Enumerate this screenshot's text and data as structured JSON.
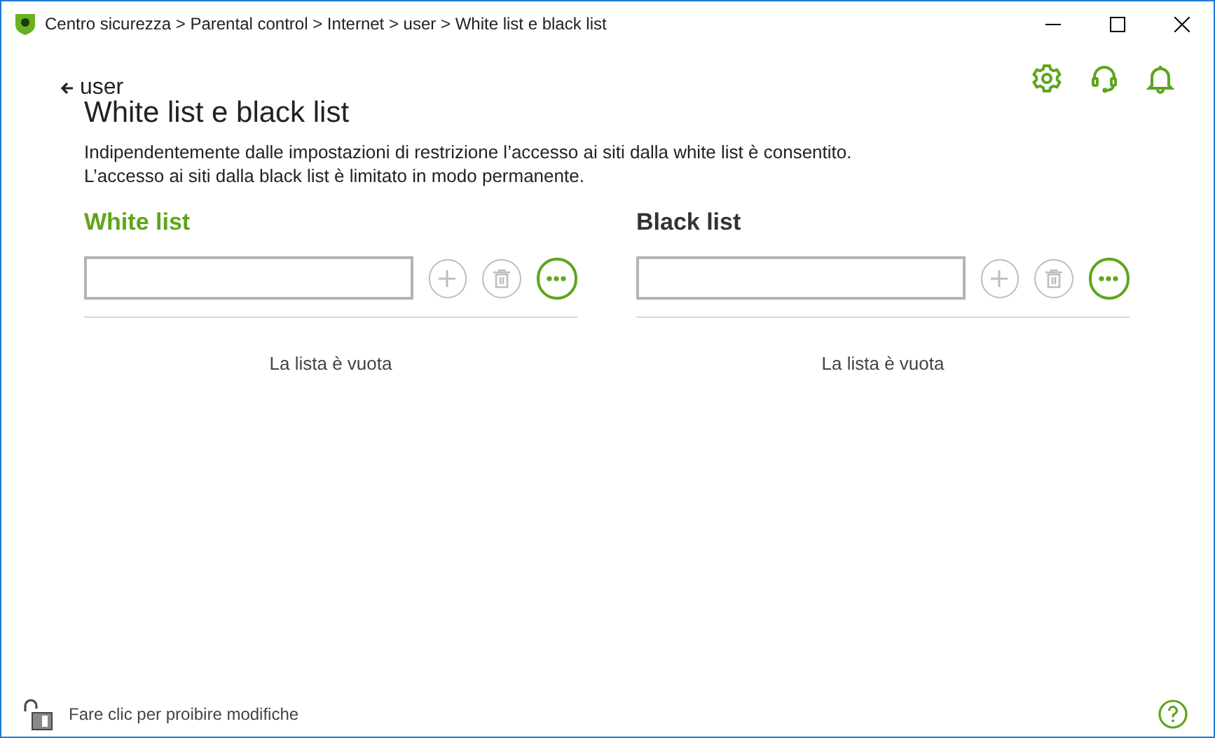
{
  "window": {
    "title": "Centro sicurezza > Parental control > Internet > user > White list e black list"
  },
  "back_link": "user",
  "heading": "White list e black list",
  "description": "Indipendentemente dalle impostazioni di restrizione l’accesso ai siti dalla white list è consentito.\nL’accesso ai siti dalla black list è limitato in modo permanente.",
  "lists": [
    {
      "title": "White list",
      "selected": true,
      "empty_text": "La lista è vuota"
    },
    {
      "title": "Black list",
      "selected": false,
      "empty_text": "La lista è vuota"
    }
  ],
  "status_bar": {
    "lock_text": "Fare clic per proibire modifiche"
  }
}
